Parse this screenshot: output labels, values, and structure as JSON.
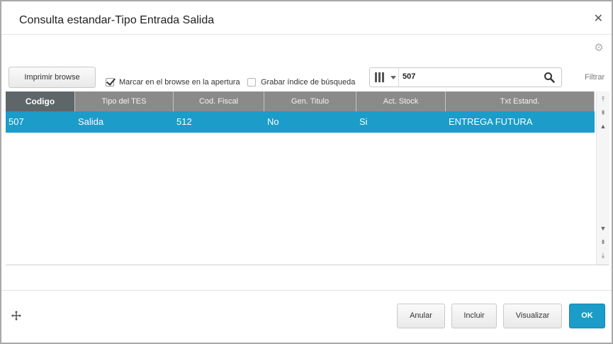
{
  "dialog": {
    "title": "Consulta estandar-Tipo Entrada Salida"
  },
  "toolbar": {
    "print_label": "Imprimir browse",
    "mark_label": "Marcar en el browse en la apertura",
    "mark_checked": true,
    "save_index_label": "Grabar índice de búsqueda",
    "save_index_checked": false,
    "search_value": "507",
    "filter_label": "Filtrar"
  },
  "grid": {
    "columns": [
      "Codigo",
      "Tipo del TES",
      "Cod. Fiscal",
      "Gen. Titulo",
      "Act. Stock",
      "Txt Estand."
    ],
    "sorted_column": "Codigo",
    "rows": [
      [
        "507",
        "Salida",
        "512",
        "No",
        "Si",
        "ENTREGA FUTURA"
      ]
    ],
    "selected_row": 0
  },
  "footer": {
    "cancel_label": "Anular",
    "include_label": "Incluir",
    "view_label": "Visualizar",
    "ok_label": "OK"
  },
  "colors": {
    "accent": "#1b9cc9",
    "header_bg": "#8a8a8a",
    "sorted_header_bg": "#5e6669"
  },
  "icons": [
    "close-icon",
    "gear-icon",
    "columns-icon",
    "chevron-down-icon",
    "search-icon",
    "move-icon",
    "scroll-top-icon",
    "scroll-page-up-icon",
    "scroll-up-icon",
    "scroll-down-icon",
    "scroll-page-down-icon",
    "scroll-bottom-icon"
  ]
}
